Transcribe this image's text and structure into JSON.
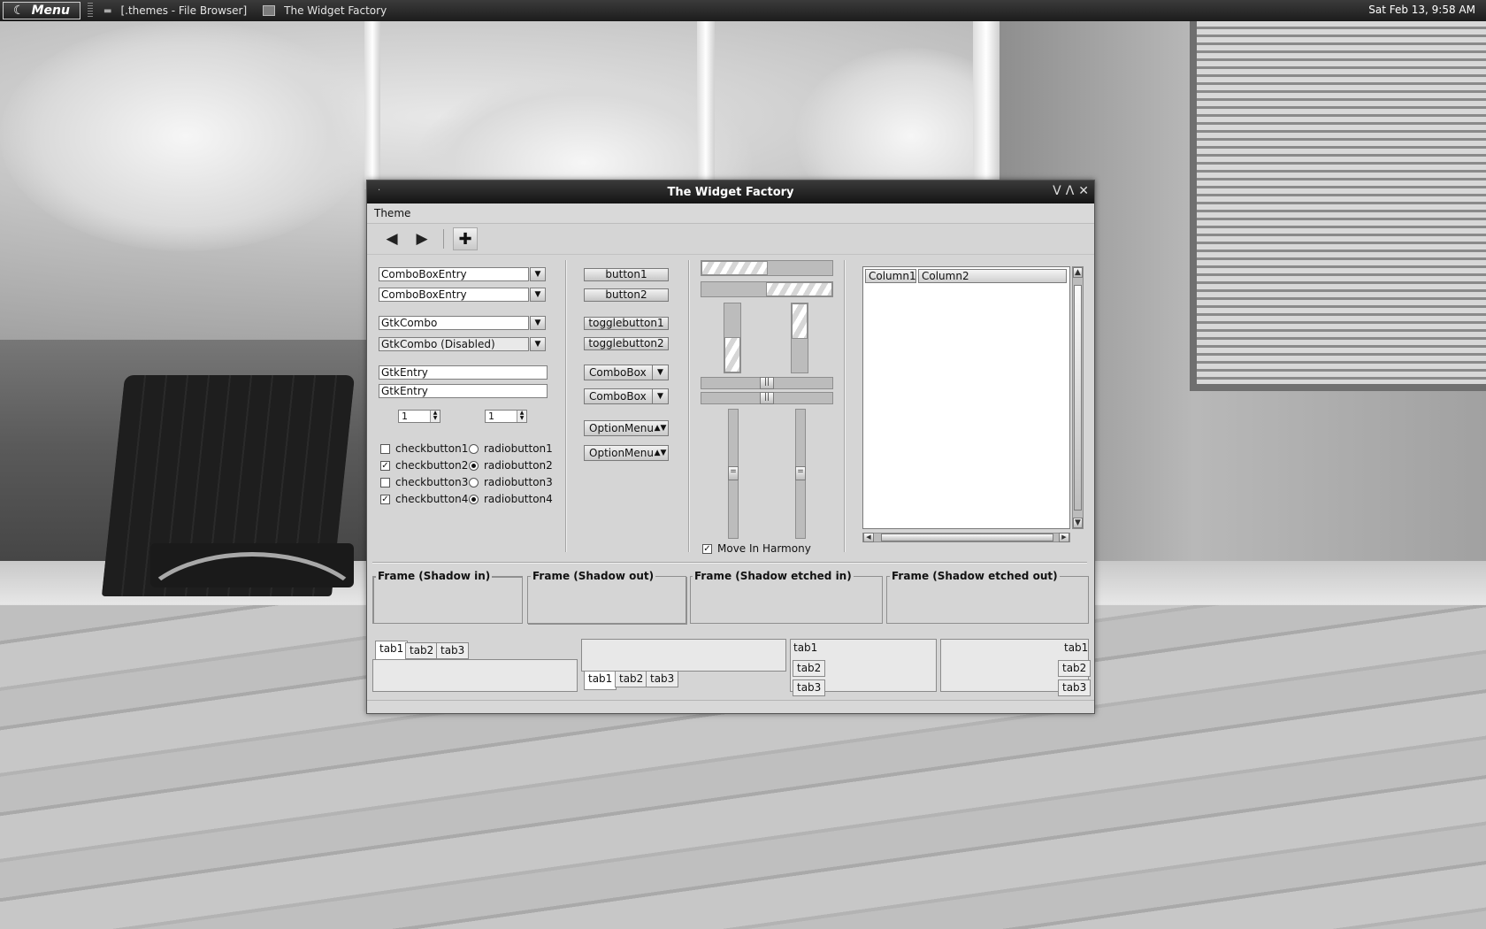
{
  "panel": {
    "menu_label": "Menu",
    "tasks": [
      "[.themes - File Browser]",
      "The Widget Factory"
    ],
    "clock": "Sat Feb 13,  9:58 AM"
  },
  "window": {
    "title": "The Widget Factory",
    "controls": [
      "V",
      "Λ",
      "✕"
    ],
    "menu": "Theme"
  },
  "col1": {
    "combo_entries": [
      "ComboBoxEntry",
      "ComboBoxEntry"
    ],
    "gtk_combos": [
      "GtkCombo",
      "GtkCombo (Disabled)"
    ],
    "entries": [
      "GtkEntry",
      "GtkEntry"
    ],
    "spins": [
      "1",
      "1"
    ],
    "checks": [
      {
        "label": "checkbutton1",
        "checked": false
      },
      {
        "label": "checkbutton2",
        "checked": true
      },
      {
        "label": "checkbutton3",
        "checked": false
      },
      {
        "label": "checkbutton4",
        "checked": true
      }
    ],
    "radios": [
      {
        "label": "radiobutton1",
        "selected": false
      },
      {
        "label": "radiobutton2",
        "selected": true
      },
      {
        "label": "radiobutton3",
        "selected": false
      },
      {
        "label": "radiobutton4",
        "selected": true
      }
    ]
  },
  "col2": {
    "buttons": [
      "button1",
      "button2"
    ],
    "toggles": [
      "togglebutton1",
      "togglebutton2"
    ],
    "comboboxes": [
      "ComboBox",
      "ComboBox"
    ],
    "optionmenus": [
      "OptionMenu",
      "OptionMenu"
    ]
  },
  "col3": {
    "harmony_label": "Move In Harmony",
    "harmony_checked": true
  },
  "col4": {
    "columns": [
      "Column1",
      "Column2"
    ]
  },
  "frames": [
    "Frame (Shadow in)",
    "Frame (Shadow out)",
    "Frame (Shadow etched in)",
    "Frame (Shadow etched out)"
  ],
  "tabs": [
    "tab1",
    "tab2",
    "tab3"
  ]
}
